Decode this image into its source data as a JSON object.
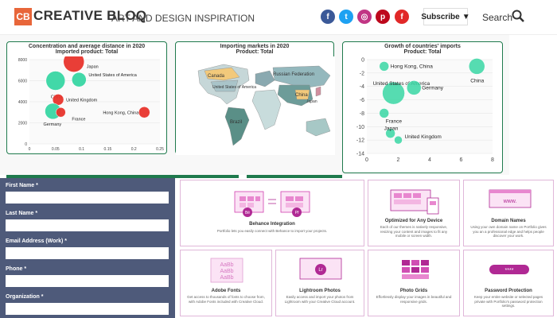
{
  "header": {
    "logo_mark": "CB",
    "logo_text": "CREATIVE BLOQ",
    "tagline": "ART AND DESIGN INSPIRATION",
    "social": [
      {
        "icon": "facebook-icon",
        "glyph": "f",
        "color": "#3b5998"
      },
      {
        "icon": "twitter-icon",
        "glyph": "t",
        "color": "#1da1f2"
      },
      {
        "icon": "instagram-icon",
        "glyph": "◎",
        "color": "#c13584"
      },
      {
        "icon": "pinterest-icon",
        "glyph": "p",
        "color": "#bd081c"
      },
      {
        "icon": "flipboard-icon",
        "glyph": "f",
        "color": "#e12828"
      }
    ],
    "subscribe_label": "Subscribe",
    "search_label": "Search"
  },
  "charts": [
    {
      "title1": "Concentration and average distance in 2020",
      "title2": "Imported product: Total",
      "x_ticks": [
        "0",
        "0.05",
        "0.1",
        "0.15",
        "0.2",
        "0.25"
      ],
      "y_ticks": [
        "8000",
        "6000",
        "4000",
        "2000",
        "0"
      ]
    },
    {
      "title1": "Importing markets in 2020",
      "title2": "Product: Total",
      "labels": [
        "Canada",
        "United States of America",
        "Russian Federation",
        "China",
        "Japan",
        "Brazil"
      ]
    },
    {
      "title1": "Growth of countries' imports",
      "title2": "Product: Total",
      "x_ticks": [
        "0",
        "2",
        "4",
        "6",
        "8"
      ],
      "y_ticks": [
        "0",
        "-2",
        "-4",
        "-6",
        "-8",
        "-10",
        "-12",
        "-14"
      ]
    }
  ],
  "chart_data": [
    {
      "type": "scatter",
      "title": "Concentration and average distance in 2020",
      "subtitle": "Imported product: Total",
      "xlim": [
        0,
        0.25
      ],
      "ylim": [
        0,
        8000
      ],
      "points": [
        {
          "label": "Japan",
          "x": 0.085,
          "y": 7800,
          "color": "#e8342c"
        },
        {
          "label": "United States of America",
          "x": 0.095,
          "y": 6100,
          "color": "#38d6a3"
        },
        {
          "label": "China",
          "x": 0.05,
          "y": 6000,
          "color": "#38d6a3"
        },
        {
          "label": "United Kingdom",
          "x": 0.055,
          "y": 4200,
          "color": "#e8342c"
        },
        {
          "label": "Germany",
          "x": 0.045,
          "y": 3100,
          "color": "#38d6a3"
        },
        {
          "label": "France",
          "x": 0.06,
          "y": 3000,
          "color": "#e8342c"
        },
        {
          "label": "Hong Kong, China",
          "x": 0.22,
          "y": 3000,
          "color": "#e8342c"
        }
      ]
    },
    {
      "type": "scatter",
      "title": "Growth of countries' imports",
      "subtitle": "Product: Total",
      "xlim": [
        0,
        8
      ],
      "ylim": [
        -14,
        0
      ],
      "points": [
        {
          "label": "Hong Kong, China",
          "x": 1.1,
          "y": -1.0
        },
        {
          "label": "China",
          "x": 7.0,
          "y": -1.0
        },
        {
          "label": "United States of America",
          "x": 1.7,
          "y": -5.0
        },
        {
          "label": "Germany",
          "x": 3.0,
          "y": -4.2
        },
        {
          "label": "France",
          "x": 1.1,
          "y": -8.0
        },
        {
          "label": "Japan",
          "x": 1.5,
          "y": -11.0
        },
        {
          "label": "United Kingdom",
          "x": 2.0,
          "y": -12.0
        }
      ]
    }
  ],
  "form": {
    "fields": [
      {
        "label": "First Name *"
      },
      {
        "label": "Last Name *"
      },
      {
        "label": "Email Address (Work) *"
      },
      {
        "label": "Phone *"
      },
      {
        "label": "Organization *"
      }
    ]
  },
  "features": [
    {
      "title": "Behance Integration",
      "desc": "Portfolio lets you easily connect with Behance to import your projects.",
      "ill_a": "Bē",
      "ill_b": "Pf"
    },
    {
      "title": "Optimized for Any Device",
      "desc": "Each of our themes is natively responsive, resizing your content and images to fit any mobile or screen width."
    },
    {
      "title": "Domain Names",
      "desc": "Using your own domain name on Portfolio gives you an a professional edge and helps people discover your work.",
      "ill": "www."
    },
    {
      "title": "Adobe Fonts",
      "desc": "Get access to thousands of fonts to choose from, with Adobe Fonts included with Creative Cloud.",
      "ill": "AaBb"
    },
    {
      "title": "Lightroom Photos",
      "desc": "Easily access and import your photos from Lightroom with your Creative Cloud account.",
      "ill": "Lr"
    },
    {
      "title": "Photo Grids",
      "desc": "Effortlessly display your images in beautiful and responsive grids."
    },
    {
      "title": "Password Protection",
      "desc": "Keep your entire website or selected pages private with Portfolio's password protection settings.",
      "ill": "****"
    }
  ]
}
